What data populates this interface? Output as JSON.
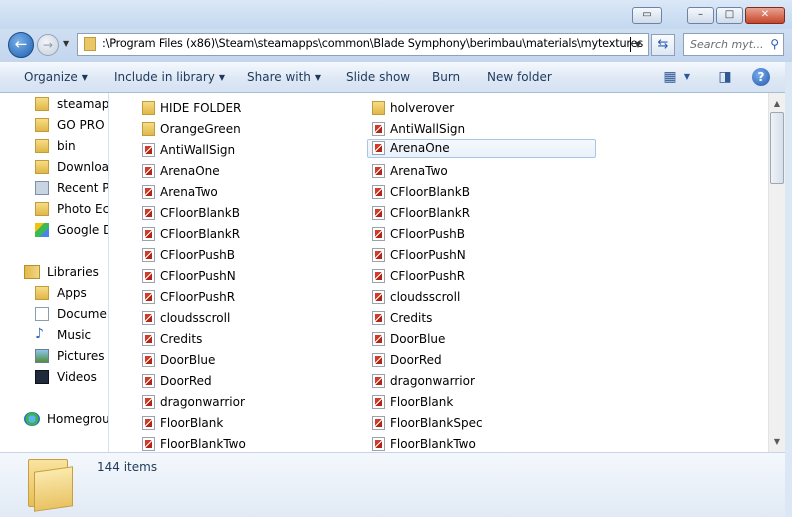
{
  "window": {
    "minimize_icon": "minimize-icon",
    "maximize_icon": "maximize-icon",
    "close_icon": "close-icon"
  },
  "address": {
    "path": ":\\Program Files (x86)\\Steam\\steamapps\\common\\Blade Symphony\\berimbau\\materials\\mytextures",
    "search_placeholder": "Search myt..."
  },
  "toolbar": {
    "organize": "Organize",
    "include_in_library": "Include in library",
    "share_with": "Share with",
    "slide_show": "Slide show",
    "burn": "Burn",
    "new_folder": "New folder"
  },
  "nav": {
    "favorites": [
      "steamap",
      "GO PRO",
      "bin",
      "Downloa",
      "Recent P",
      "Photo Ec",
      "Google D"
    ],
    "libraries_label": "Libraries",
    "libraries": [
      "Apps",
      "Docume",
      "Music",
      "Pictures",
      "Videos"
    ],
    "homegroup": "Homegrou"
  },
  "files": {
    "col1": [
      "HIDE FOLDER",
      "OrangeGreen",
      "AntiWallSign",
      "ArenaOne",
      "ArenaTwo",
      "CFloorBlankB",
      "CFloorBlankR",
      "CFloorPushB",
      "CFloorPushN",
      "CFloorPushR",
      "cloudsscroll",
      "Credits",
      "DoorBlue",
      "DoorRed",
      "dragonwarrior",
      "FloorBlank",
      "FloorBlankTwo"
    ],
    "col2": [
      "holverover",
      "AntiWallSign",
      "ArenaOne",
      "ArenaTwo",
      "CFloorBlankB",
      "CFloorBlankR",
      "CFloorPushB",
      "CFloorPushN",
      "CFloorPushR",
      "cloudsscroll",
      "Credits",
      "DoorBlue",
      "DoorRed",
      "dragonwarrior",
      "FloorBlank",
      "FloorBlankSpec",
      "FloorBlankTwo"
    ],
    "folders_col1": 2,
    "folders_col2": 1,
    "selected": "ArenaOne"
  },
  "status": {
    "item_count": "144 items"
  }
}
